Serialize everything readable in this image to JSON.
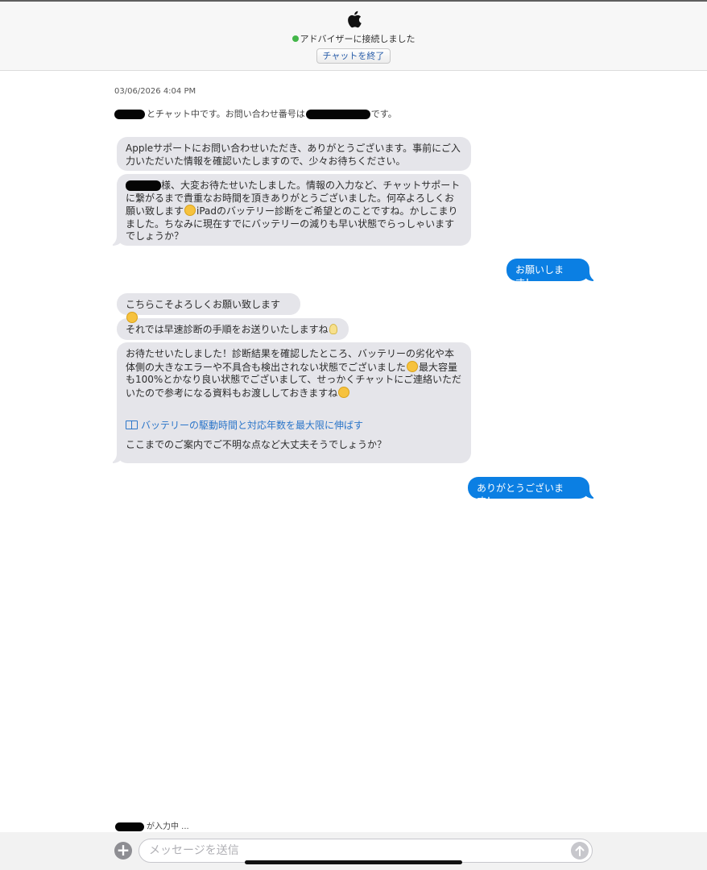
{
  "header": {
    "logo_icon": "apple-logo-icon",
    "status_text": "アドバイザーに接続しました",
    "status_color": "#43b649",
    "end_chat_label": "チャットを終了"
  },
  "chat": {
    "timestamp": "03/06/2026 4:04 PM",
    "system_line": {
      "part1": "とチャット中です。お問い合わせ番号は",
      "part2": "です。"
    },
    "messages": [
      {
        "from": "advisor",
        "text": "Appleサポートにお問い合わせいただき、ありがとうございます。事前にご入力いただいた情報を確認いたしますので、少々お待ちください。"
      },
      {
        "from": "advisor",
        "text_a": "様、大変お待たせいたしました。情報の入力など、チャットサポートに繋がるまで貴重なお時間を頂きありがとうございました。何卒よろしくお願い致します",
        "text_b": "iPadのバッテリー診断をご希望とのことですね。かしこまりました。ちなみに現在すでにバッテリーの減りも早い状態でらっしゃいますでしょうか？"
      },
      {
        "from": "user",
        "text": "お願いします！"
      },
      {
        "from": "advisor",
        "text": "こちらこそよろしくお願い致します"
      },
      {
        "from": "advisor",
        "text": "それでは早速診断の手順をお送りいたしますね"
      },
      {
        "from": "advisor",
        "text_a": "お待たせいたしました！診断結果を確認したところ、バッテリーの劣化や本体側の大きなエラーや不具合も検出されない状態でございました",
        "text_b": "最大容量も100%とかなり良い状態でございまして、せっかくチャットにご連絡いただいたので参考になる資料もお渡ししておきますね",
        "link_text": "バッテリーの駆動時間と対応年数を最大限に伸ばす",
        "text_c": "ここまでのご案内でご不明な点など大丈夫そうでしょうか？"
      },
      {
        "from": "user",
        "text": "ありがとうございます！"
      }
    ],
    "accent_color": "#0b7fe3"
  },
  "footer": {
    "typing_text": "が入力中 ...",
    "input_placeholder": "メッセージを送信",
    "input_value": ""
  }
}
